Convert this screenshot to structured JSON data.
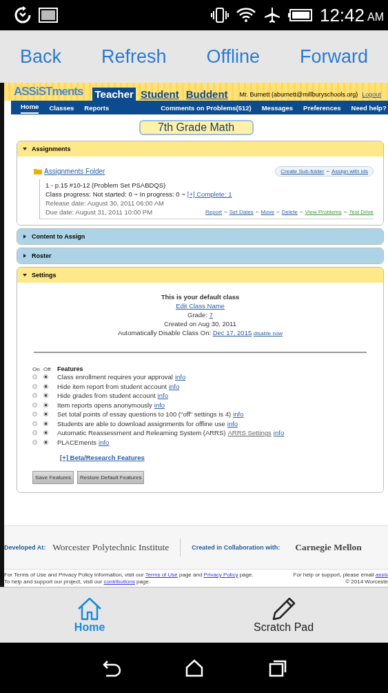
{
  "status_bar": {
    "time": "12:42",
    "ampm": "AM"
  },
  "browser_toolbar": [
    "Back",
    "Refresh",
    "Offline",
    "Forward"
  ],
  "header": {
    "logo": "ASSiSTments",
    "roles": [
      {
        "label": "Teacher",
        "selected": true
      },
      {
        "label": "Student",
        "selected": false
      },
      {
        "label": "Buddent",
        "selected": false
      }
    ],
    "user": "Mr. Burnett (aburnett@millburyschools.org)",
    "logout": "Logout"
  },
  "nav": [
    {
      "label": "Home",
      "selected": true
    },
    {
      "label": "Classes",
      "selected": false
    },
    {
      "label": "Reports",
      "selected": false
    },
    {
      "label": "Comments on Problems(512)",
      "selected": false
    },
    {
      "label": "Messages",
      "selected": false
    },
    {
      "label": "Preferences",
      "selected": false
    },
    {
      "label": "Need help?",
      "selected": false
    }
  ],
  "class_title": "7th Grade Math",
  "panels": [
    {
      "title": "Assignments",
      "expanded": true
    },
    {
      "title": "Content to Assign",
      "expanded": false
    },
    {
      "title": "Roster",
      "expanded": false
    },
    {
      "title": "Settings",
      "expanded": true
    }
  ],
  "assignments": {
    "separator": "~",
    "folder": "Assignments Folder",
    "folder_actions": [
      "Create Sub-folder",
      "Assign with ids"
    ],
    "item": {
      "title": "1 - p.15 #10-12 (Problem Set PSABDQS)",
      "progress": "Class progress: Not started: 0 ~ In progress: 0 ~",
      "complete": "[+] Complete: 1",
      "release": "Release date: August 30, 2011 06:00 AM",
      "due": "Due date: August 31, 2011 10:00 PM",
      "actions": [
        {
          "label": "Report",
          "kind": "normal"
        },
        {
          "label": "Set Dates",
          "kind": "normal"
        },
        {
          "label": "Move",
          "kind": "normal"
        },
        {
          "label": "Delete",
          "kind": "normal"
        },
        {
          "label": "View Problems",
          "kind": "green"
        },
        {
          "label": "Test Drive",
          "kind": "green"
        }
      ]
    }
  },
  "settings": {
    "default_note": "This is your default class",
    "edit_name": "Edit Class Name",
    "grade_label": "Grade:",
    "grade": "7",
    "created": "Created on Aug 30, 2011",
    "disable_label": "Automatically Disable Class On:",
    "disable_date": "Dec 17, 2015",
    "disable_now": "disable now",
    "col_on": "On",
    "col_off": "Off",
    "features_heading": "Features",
    "features": [
      {
        "label": "Class enrollment requires your approval",
        "on": false,
        "info": "info"
      },
      {
        "label": "Hide item report from student account",
        "on": false,
        "info": "info"
      },
      {
        "label": "Hide grades from student account",
        "on": false,
        "info": "info"
      },
      {
        "label": "Item reports opens anonymously",
        "on": false,
        "info": "info"
      },
      {
        "label": "Set total points of essay questions to 100 (\"off\" settings is 4)",
        "on": false,
        "info": "info"
      },
      {
        "label": "Students are able to download assignments for offline use",
        "on": false,
        "info": "info"
      },
      {
        "label": "Automatic Reassessment and Relearning System (ARRS)",
        "on": false,
        "extra": "ARRS Settings",
        "info": "info"
      },
      {
        "label": "PLACEments",
        "on": false,
        "info": "info"
      }
    ],
    "beta": "[+] Beta/Research Features",
    "buttons": [
      "Save Features",
      "Restore Default Features"
    ]
  },
  "footer": {
    "developed_label": "Developed At:",
    "developed_org": "Worcester Polytechnic Institute",
    "collab_label": "Created in Collaboration with:",
    "collab_org": "Carnegie Mellon",
    "terms_pre": "For Terms of Use and Privacy Policy information, visit our",
    "terms_link": "Terms of Use",
    "terms_mid": "page and",
    "privacy_link": "Privacy Policy",
    "terms_post": "page.",
    "help_pre": "For help or support, please email",
    "help_link": "assis",
    "support_pre": "To help and support our project, visit our",
    "support_link": "contributions",
    "support_post": "page.",
    "copyright": "© 2014 Worceste"
  },
  "bottom_nav": [
    {
      "label": "Home",
      "selected": true
    },
    {
      "label": "Scratch Pad",
      "selected": false
    }
  ]
}
